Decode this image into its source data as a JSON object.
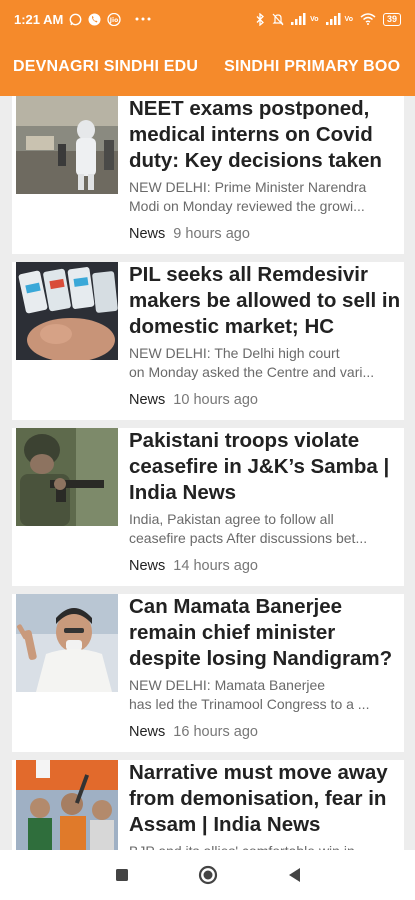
{
  "status": {
    "time": "1:21 AM",
    "left_icons": [
      "whatsapp-icon",
      "call-icon",
      "jio-icon",
      "more-dots-icon"
    ],
    "right_icons": [
      "bluetooth-icon",
      "mute-icon",
      "signal-icon",
      "signal-icon",
      "wifi-icon"
    ],
    "signal_label_1": "Vo",
    "signal_label_2": "Vo",
    "battery": "39"
  },
  "tabs": [
    {
      "label": "DEVNAGRI SINDHI EDU"
    },
    {
      "label": "SINDHI PRIMARY BOO"
    }
  ],
  "articles": [
    {
      "title": "NEET exams postponed, medical interns on Covid duty: Key decisions taken",
      "summary_line1": "NEW DELHI: Prime Minister Narendra",
      "summary_line2": "Modi on Monday reviewed the growi...",
      "category": "News",
      "time": "9 hours ago"
    },
    {
      "title": "PIL seeks all Remdesivir makers be allowed to sell in domestic market; HC",
      "summary_line1": "NEW DELHI: The Delhi high court",
      "summary_line2": "on Monday asked the Centre and vari...",
      "category": "News",
      "time": "10 hours ago"
    },
    {
      "title": "Pakistani troops violate ceasefire in J&K’s Samba | India News",
      "summary_line1": "India, Pakistan agree to follow all",
      "summary_line2": "ceasefire pacts After discussions bet...",
      "category": "News",
      "time": "14 hours ago"
    },
    {
      "title": "Can Mamata Banerjee remain chief minister despite losing Nandigram?",
      "summary_line1": "NEW DELHI: Mamata Banerjee",
      "summary_line2": "has led the Trinamool Congress to a ...",
      "category": "News",
      "time": "16 hours ago"
    },
    {
      "title": "Narrative must move away from demonisation, fear in Assam | India News",
      "summary_line1": "BJP and its allies' comfortable win in",
      "summary_line2": "",
      "category": "",
      "time": ""
    }
  ],
  "colors": {
    "accent": "#f58a2b",
    "background": "#ededed",
    "title": "#222222",
    "summary": "#6a6a6a"
  },
  "navbar": {
    "buttons": [
      "recents-square-icon",
      "home-circle-icon",
      "back-triangle-icon"
    ]
  }
}
